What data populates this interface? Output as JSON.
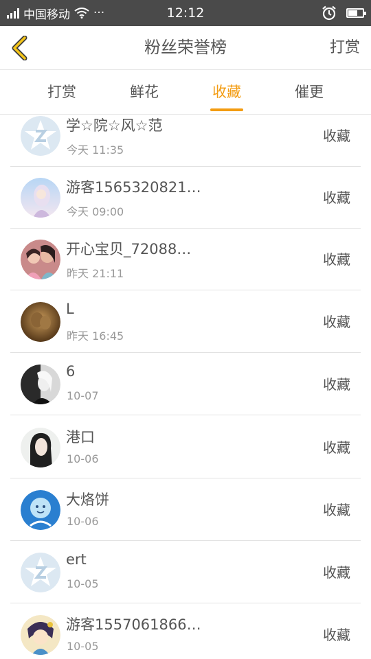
{
  "status": {
    "carrier": "中国移动",
    "time": "12:12",
    "more": "···"
  },
  "header": {
    "title": "粉丝荣誉榜",
    "action": "打赏"
  },
  "tabs": [
    {
      "label": "打赏",
      "active": false
    },
    {
      "label": "鲜花",
      "active": false
    },
    {
      "label": "收藏",
      "active": true
    },
    {
      "label": "催更",
      "active": false
    }
  ],
  "list": [
    {
      "name": "学☆院☆风☆范",
      "date": "今天 11:35",
      "badge": "收藏",
      "avatar": "default-avatar"
    },
    {
      "name": "游客1565320821…",
      "date": "今天 09:00",
      "badge": "收藏",
      "avatar": "anime-avatar"
    },
    {
      "name": "开心宝贝_72088…",
      "date": "昨天 21:11",
      "badge": "收藏",
      "avatar": "photo-avatar"
    },
    {
      "name": "L",
      "date": "昨天 16:45",
      "badge": "收藏",
      "avatar": "photo-avatar"
    },
    {
      "name": "6",
      "date": "10-07",
      "badge": "收藏",
      "avatar": "photo-avatar"
    },
    {
      "name": "港口",
      "date": "10-06",
      "badge": "收藏",
      "avatar": "photo-avatar"
    },
    {
      "name": "大烙饼",
      "date": "10-06",
      "badge": "收藏",
      "avatar": "art-avatar"
    },
    {
      "name": "ert",
      "date": "10-05",
      "badge": "收藏",
      "avatar": "default-avatar"
    },
    {
      "name": "游客1557061866…",
      "date": "10-05",
      "badge": "收藏",
      "avatar": "anime-avatar"
    }
  ],
  "colors": {
    "accent": "#f39c12",
    "statusbar": "#4a4a4a",
    "text": "#555555",
    "subtext": "#999999"
  }
}
